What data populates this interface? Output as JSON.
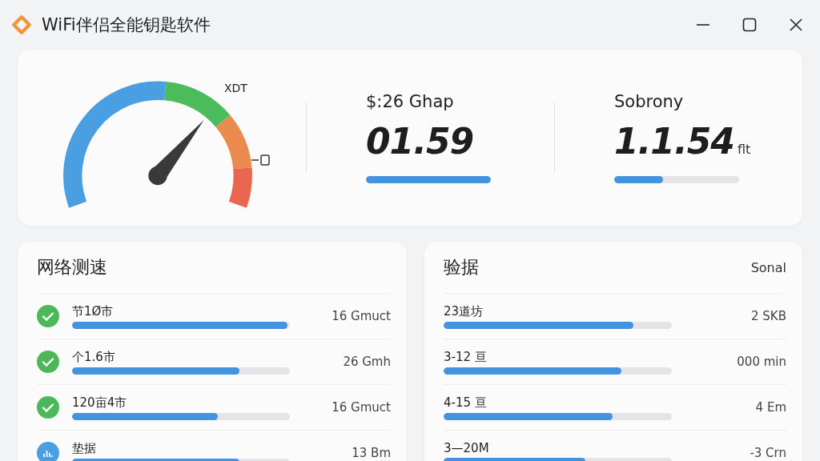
{
  "window": {
    "title": "WiFi伴侣全能钥匙软件"
  },
  "gauge": {
    "level": 0.68,
    "label": "XDT"
  },
  "stats": [
    {
      "label": "$:26 Ghap",
      "value": "01.59",
      "level": 1.0
    },
    {
      "label": "Sobrony",
      "value": "1.1.54",
      "unit": "flt",
      "level": 0.39
    }
  ],
  "left_panel": {
    "title": "网络测速",
    "rows": [
      {
        "kind": "check",
        "label": "节1Ø市",
        "level": 0.99,
        "reading": "16 Gmuct"
      },
      {
        "kind": "check",
        "label": "个1.6市",
        "level": 0.77,
        "reading": "26 Gmh"
      },
      {
        "kind": "check",
        "label": "120亩4市",
        "level": 0.67,
        "reading": "16 Gmuct"
      },
      {
        "kind": "chart",
        "label": "垫据",
        "level": 0.77,
        "reading": "13 Bm"
      }
    ]
  },
  "right_panel": {
    "title": "验据",
    "header_right": "Sonal",
    "rows": [
      {
        "label": "23道坊",
        "level": 0.83,
        "reading": "2 SKB"
      },
      {
        "label": "3-12 亘",
        "level": 0.78,
        "reading": "000 min"
      },
      {
        "label": "4-15 亘",
        "level": 0.74,
        "reading": "4 Em"
      },
      {
        "label": "3—20M",
        "level": 0.62,
        "reading": "-3 Crn"
      }
    ]
  }
}
